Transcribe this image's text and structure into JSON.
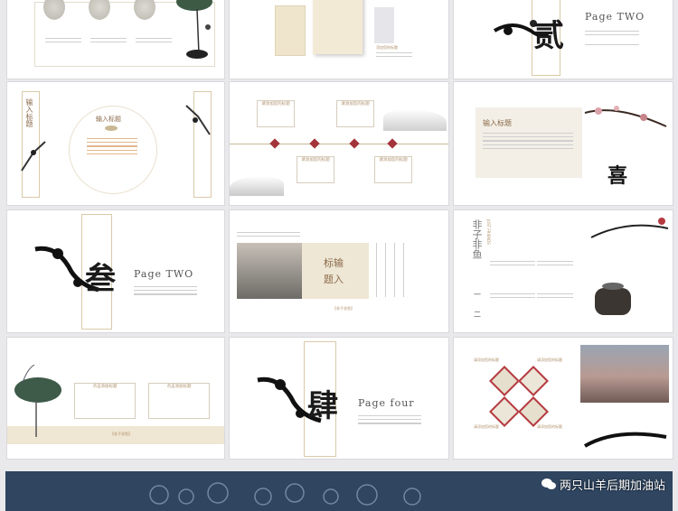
{
  "slides": {
    "s3": {
      "page": "Page  TWO",
      "char": "贰"
    },
    "s4": {
      "vertical_title": "输入标题",
      "circle_title": "输入标题"
    },
    "s5": {
      "labels": [
        "请添加您的标题",
        "请添加您的标题",
        "请添加您的标题",
        "请添加您的标题"
      ]
    },
    "s6": {
      "title": "输入标题",
      "seal": "喜"
    },
    "s7": {
      "page": "Page  TWO",
      "char": "叁"
    },
    "s8": {
      "title_l1": "标输",
      "title_l2": "题入",
      "tag": "【非子非鱼】"
    },
    "s9": {
      "title": "非子非鱼",
      "sub": "JUST FRIENDS",
      "n1": "一",
      "n2": "二"
    },
    "s10": {
      "labels": [
        "点击添加标题",
        "点击添加标题"
      ],
      "tag": "【非子非鱼】"
    },
    "s11": {
      "page": "Page  four",
      "char": "肆"
    },
    "s12": {
      "labels": [
        "请添加您的标题",
        "请添加您的标题",
        "请添加您的标题",
        "请添加您的标题"
      ]
    },
    "s2": {
      "label": "添加您的标题"
    }
  },
  "watermark": {
    "text": "两只山羊后期加油站",
    "icon": "wechat-icon"
  }
}
